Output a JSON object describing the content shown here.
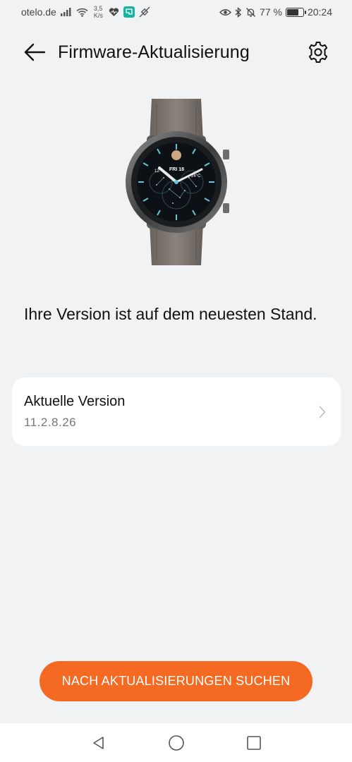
{
  "status_bar": {
    "carrier": "otelo.de",
    "speed_value": "3,5",
    "speed_unit": "K/s",
    "battery_percent": "77 %",
    "battery_level": 0.77,
    "time": "20:24",
    "icons": [
      "signal-icon",
      "wifi-icon",
      "health-icon",
      "app-badge-icon",
      "satellite-icon",
      "eye-icon",
      "bluetooth-icon",
      "bell-off-icon",
      "battery-icon"
    ]
  },
  "header": {
    "title": "Firmware-Aktualisierung",
    "back_icon": "arrow-left-icon",
    "settings_icon": "gear-icon"
  },
  "watch": {
    "day_label": "FRI 18",
    "temp_label": "24°C"
  },
  "status_message": "Ihre Version ist auf dem neuesten Stand.",
  "version_card": {
    "label": "Aktuelle Version",
    "value": "11.2.8.26"
  },
  "update_button": {
    "label": "NACH AKTUALISIERUNGEN SUCHEN",
    "color": "#f46a23"
  },
  "nav_bar": {
    "icons": [
      "back-triangle-icon",
      "home-circle-icon",
      "recents-square-icon"
    ]
  }
}
